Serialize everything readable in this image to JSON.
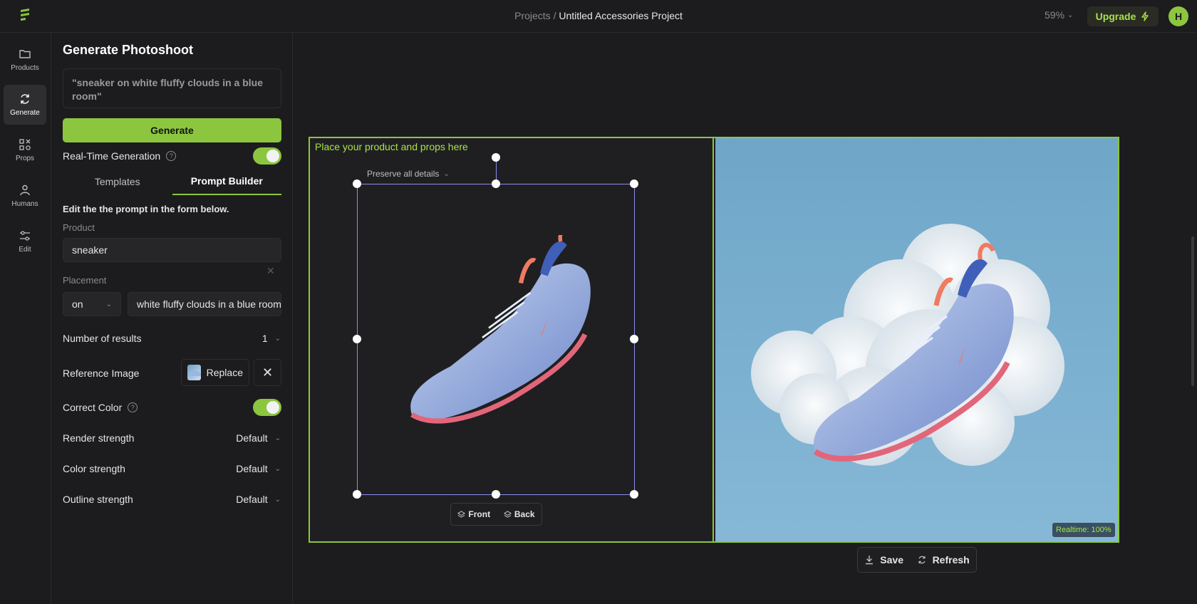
{
  "header": {
    "breadcrumb_root": "Projects",
    "breadcrumb_sep": "/",
    "project_name": "Untitled Accessories Project",
    "zoom": "59%",
    "upgrade_label": "Upgrade",
    "avatar_initial": "H"
  },
  "rail": {
    "items": [
      {
        "label": "Products",
        "icon": "folder-icon"
      },
      {
        "label": "Generate",
        "icon": "refresh-icon"
      },
      {
        "label": "Props",
        "icon": "shapes-icon"
      },
      {
        "label": "Humans",
        "icon": "person-icon"
      },
      {
        "label": "Edit",
        "icon": "sliders-icon"
      }
    ]
  },
  "panel": {
    "title": "Generate Photoshoot",
    "prompt": "\"sneaker on white fluffy clouds in a blue room\"",
    "generate_label": "Generate",
    "realtime_label": "Real-Time Generation",
    "tabs": [
      "Templates",
      "Prompt Builder"
    ],
    "form_hint": "Edit the the prompt in the form below.",
    "product_label": "Product",
    "product_value": "sneaker",
    "placement_label": "Placement",
    "placement_preposition": "on",
    "placement_value": "white fluffy clouds in a blue room",
    "results_label": "Number of results",
    "results_value": "1",
    "reference_label": "Reference Image",
    "replace_label": "Replace",
    "correct_color_label": "Correct Color",
    "render_label": "Render strength",
    "render_value": "Default",
    "color_label": "Color strength",
    "color_value": "Default",
    "outline_label": "Outline strength",
    "outline_value": "Default"
  },
  "canvas": {
    "hint": "Place your product and props here",
    "preserve_label": "Preserve all details",
    "front_label": "Front",
    "back_label": "Back",
    "realtime_badge": "Realtime: 100%",
    "save_label": "Save",
    "refresh_label": "Refresh"
  },
  "colors": {
    "accent": "#8cc63f",
    "background": "#1c1c1e",
    "sky": "#6fa6c8"
  }
}
